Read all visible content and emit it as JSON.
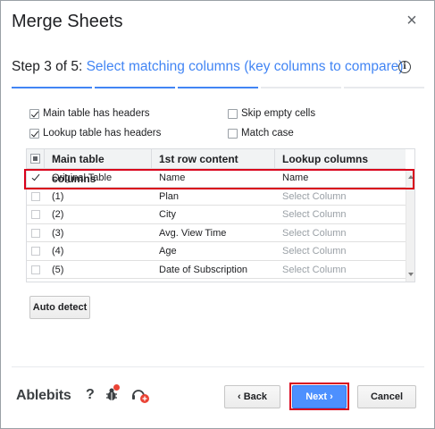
{
  "dialog": {
    "title": "Merge Sheets",
    "close_label": "×"
  },
  "step": {
    "number": "Step 3 of 5:",
    "description": "Select matching columns (key columns to compare)",
    "info_icon_label": "i",
    "progress": {
      "completed": 3,
      "total": 5
    }
  },
  "options": {
    "main_headers": {
      "label": "Main table has headers",
      "checked": true
    },
    "lookup_headers": {
      "label": "Lookup table has headers",
      "checked": true
    },
    "skip_empty": {
      "label": "Skip empty cells",
      "checked": false
    },
    "match_case": {
      "label": "Match case",
      "checked": false
    }
  },
  "table": {
    "headers": [
      "Main table columns",
      "1st row content",
      "Lookup columns"
    ],
    "rows": [
      {
        "checked": true,
        "main": "Original Table",
        "content": "Name",
        "lookup": "Name",
        "placeholder": false
      },
      {
        "checked": false,
        "main": "(1)",
        "content": "Plan",
        "lookup": "Select Column",
        "placeholder": true
      },
      {
        "checked": false,
        "main": "(2)",
        "content": "City",
        "lookup": "Select Column",
        "placeholder": true
      },
      {
        "checked": false,
        "main": "(3)",
        "content": "Avg. View Time",
        "lookup": "Select Column",
        "placeholder": true
      },
      {
        "checked": false,
        "main": "(4)",
        "content": "Age",
        "lookup": "Select Column",
        "placeholder": true
      },
      {
        "checked": false,
        "main": "(5)",
        "content": "Date of Subscription",
        "lookup": "Select Column",
        "placeholder": true
      }
    ]
  },
  "buttons": {
    "auto_detect": "Auto detect",
    "back": "‹ Back",
    "next": "Next ›",
    "cancel": "Cancel"
  },
  "footer": {
    "brand": "Ablebits",
    "help": "?",
    "bug_icon": "bug-icon",
    "support_icon": "support-icon"
  },
  "colors": {
    "accent": "#4285f4",
    "highlight": "#d9001b",
    "primary_button": "#4d90fe"
  }
}
